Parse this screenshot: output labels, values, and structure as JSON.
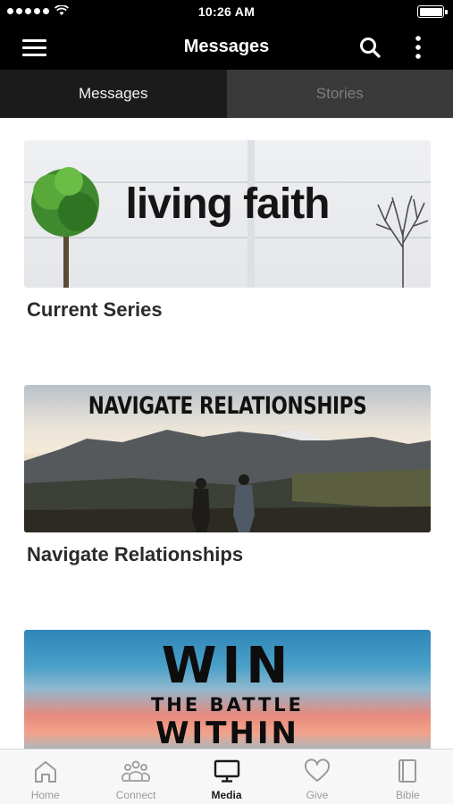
{
  "status_bar": {
    "time": "10:26 AM"
  },
  "nav": {
    "title": "Messages"
  },
  "tabs": [
    {
      "label": "Messages",
      "active": true
    },
    {
      "label": "Stories",
      "active": false
    }
  ],
  "cards": [
    {
      "image_text": "living faith",
      "title": "Current Series"
    },
    {
      "image_text": "NAVIGATE RELATIONSHIPS",
      "title": "Navigate Relationships"
    },
    {
      "image_text_line1": "WIN",
      "image_text_line2": "THE BATTLE",
      "image_text_line3": "WITHIN"
    }
  ],
  "tab_bar": {
    "items": [
      {
        "label": "Home",
        "icon": "home-icon",
        "active": false
      },
      {
        "label": "Connect",
        "icon": "connect-icon",
        "active": false
      },
      {
        "label": "Media",
        "icon": "media-icon",
        "active": true
      },
      {
        "label": "Give",
        "icon": "heart-icon",
        "active": false
      },
      {
        "label": "Bible",
        "icon": "bible-icon",
        "active": false
      }
    ]
  },
  "colors": {
    "bar_background": "#000000",
    "tab_active": "#1b1b1b",
    "tab_inactive": "#3a3a3a",
    "title_text": "#2b2b2b"
  }
}
